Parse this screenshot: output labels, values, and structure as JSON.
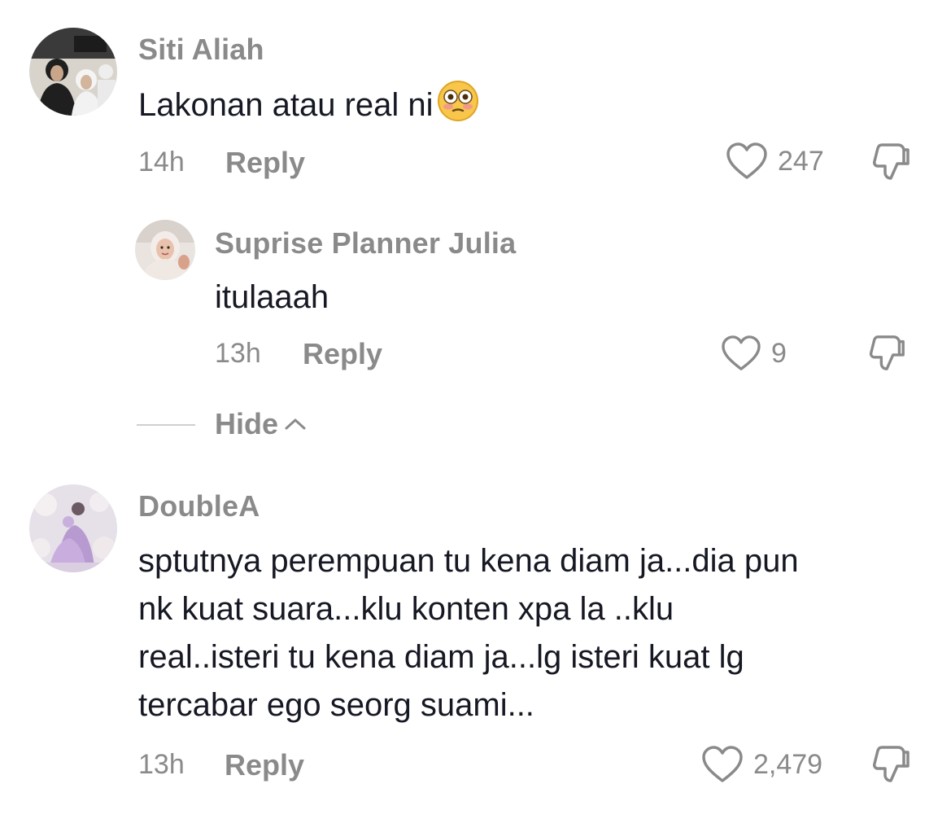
{
  "comments": [
    {
      "username": "Siti Aliah",
      "text": "Lakonan atau real ni",
      "emoji": "flushed-face",
      "time": "14h",
      "reply_label": "Reply",
      "likes": "247"
    },
    {
      "username": "Suprise Planner Julia",
      "text": "itulaaah",
      "time": "13h",
      "reply_label": "Reply",
      "likes": "9"
    },
    {
      "username": "DoubleA",
      "text_lines": [
        "sptutnya perempuan tu kena diam ja...dia pun",
        "nk kuat suara...klu konten xpa la ..klu",
        "real..isteri tu kena diam ja...lg isteri kuat lg",
        "tercabar ego seorg suami..."
      ],
      "time": "13h",
      "reply_label": "Reply",
      "likes": "2,479"
    }
  ],
  "hide_replies": {
    "label": "Hide"
  },
  "colors": {
    "muted": "#8a8a8a",
    "text": "#161823",
    "divider": "#cfcfcf"
  }
}
